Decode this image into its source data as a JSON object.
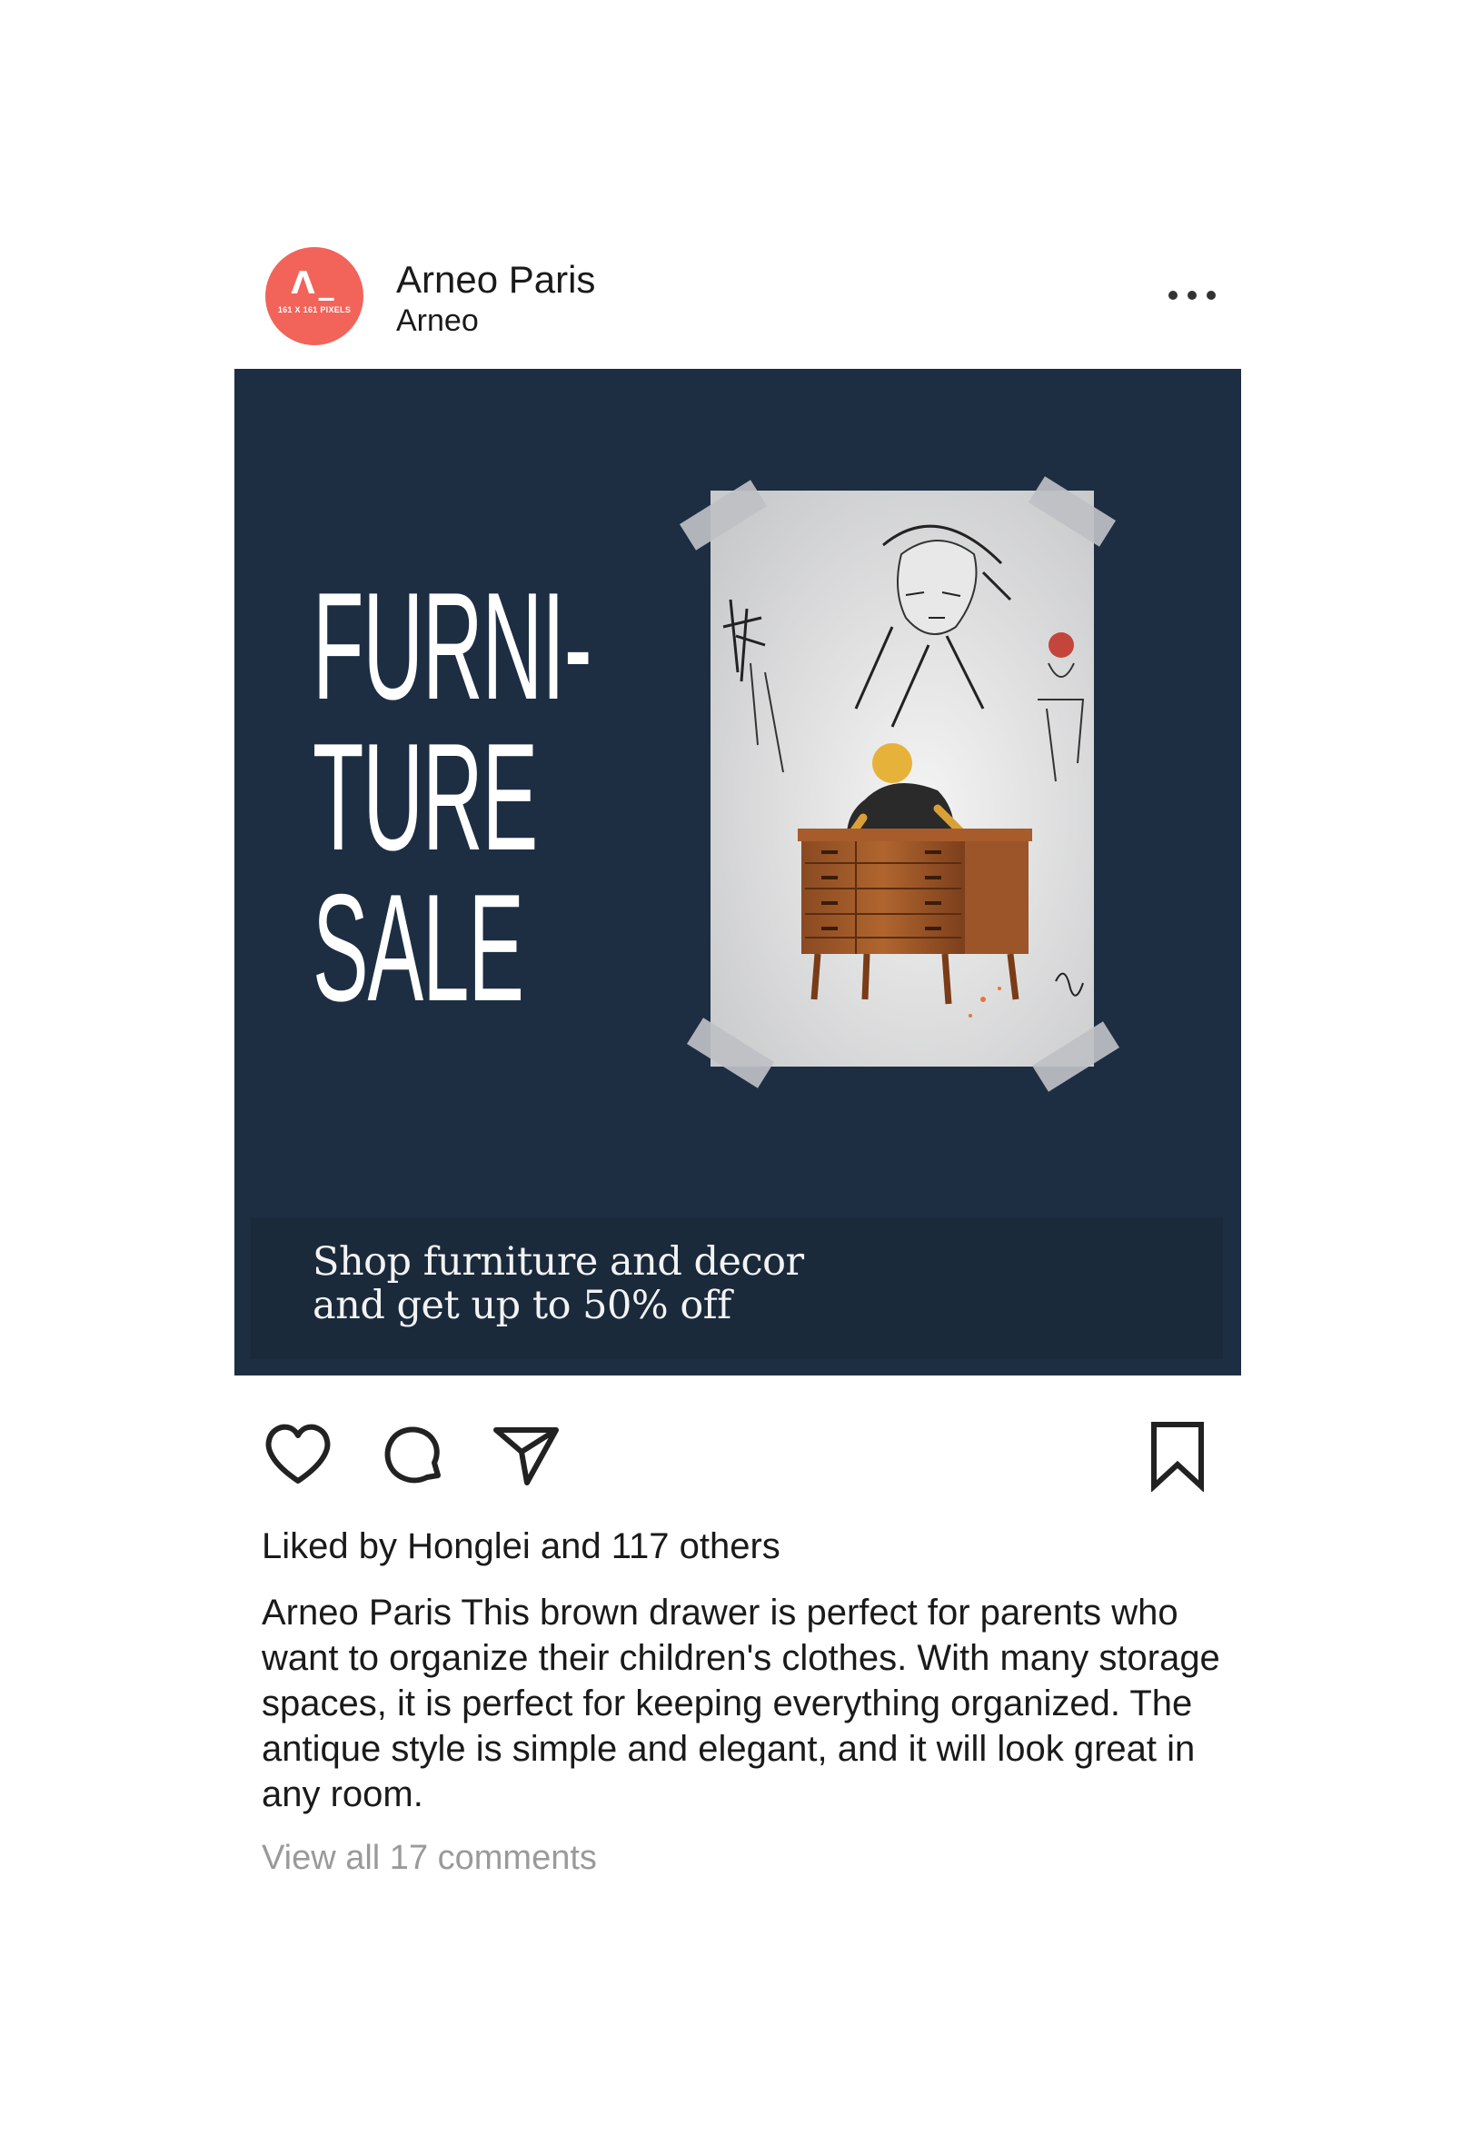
{
  "account": {
    "avatar_mark": "Λ_",
    "avatar_subtext": "161 X 161 PIXELS",
    "name": "Arneo Paris",
    "handle": "Arneo",
    "avatar_color": "#f2635a"
  },
  "post": {
    "background_color": "#1d2e43",
    "headline_lines": [
      "FURNI-",
      "TURE",
      "SALE"
    ],
    "banner_line1": "Shop furniture and decor",
    "banner_line2": "and get up to 50% off"
  },
  "actions": {
    "like_icon": "heart-icon",
    "comment_icon": "comment-icon",
    "share_icon": "send-icon",
    "save_icon": "bookmark-icon"
  },
  "likes_text": "Liked by Honglei and 117 others",
  "caption": "Arneo Paris This brown drawer is perfect for parents who want to organize their children's clothes. With many storage spaces, it is perfect for keeping everything organized. The antique style is simple and elegant, and it will look great in any room.",
  "comments_link": "View all 17 comments"
}
